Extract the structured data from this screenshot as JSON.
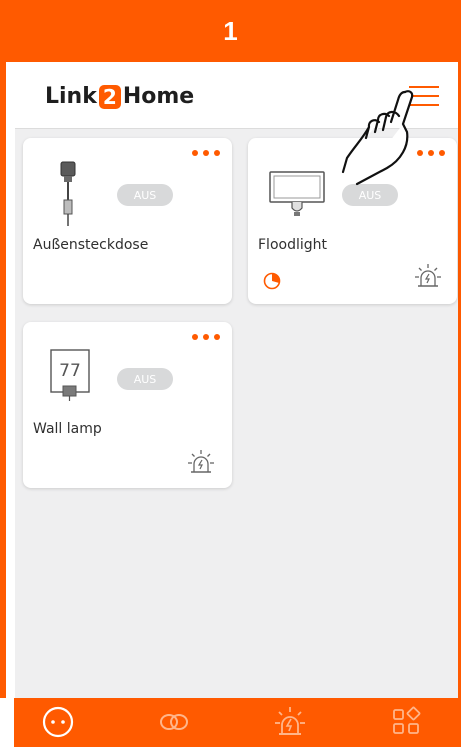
{
  "step": {
    "number": "1"
  },
  "header": {
    "logo_prefix": "Link",
    "logo_digit": "2",
    "logo_suffix": "Home",
    "menu_icon": "hamburger-icon"
  },
  "devices": [
    {
      "name": "Außensteckdose",
      "state": "AUS",
      "icon": "outdoor-socket-icon"
    },
    {
      "name": "Floodlight",
      "state": "AUS",
      "icon": "floodlight-icon"
    },
    {
      "name": "Wall lamp",
      "state": "AUS",
      "icon": "wall-lamp-icon",
      "lamp_label": "77"
    }
  ],
  "bottom_nav": [
    {
      "icon": "socket-icon",
      "active": true
    },
    {
      "icon": "link-icon",
      "active": false
    },
    {
      "icon": "alarm-icon",
      "active": false
    },
    {
      "icon": "apps-icon",
      "active": false
    }
  ],
  "colors": {
    "accent": "#ff5a00",
    "background": "#efeff0",
    "pill": "#d8d9da"
  }
}
